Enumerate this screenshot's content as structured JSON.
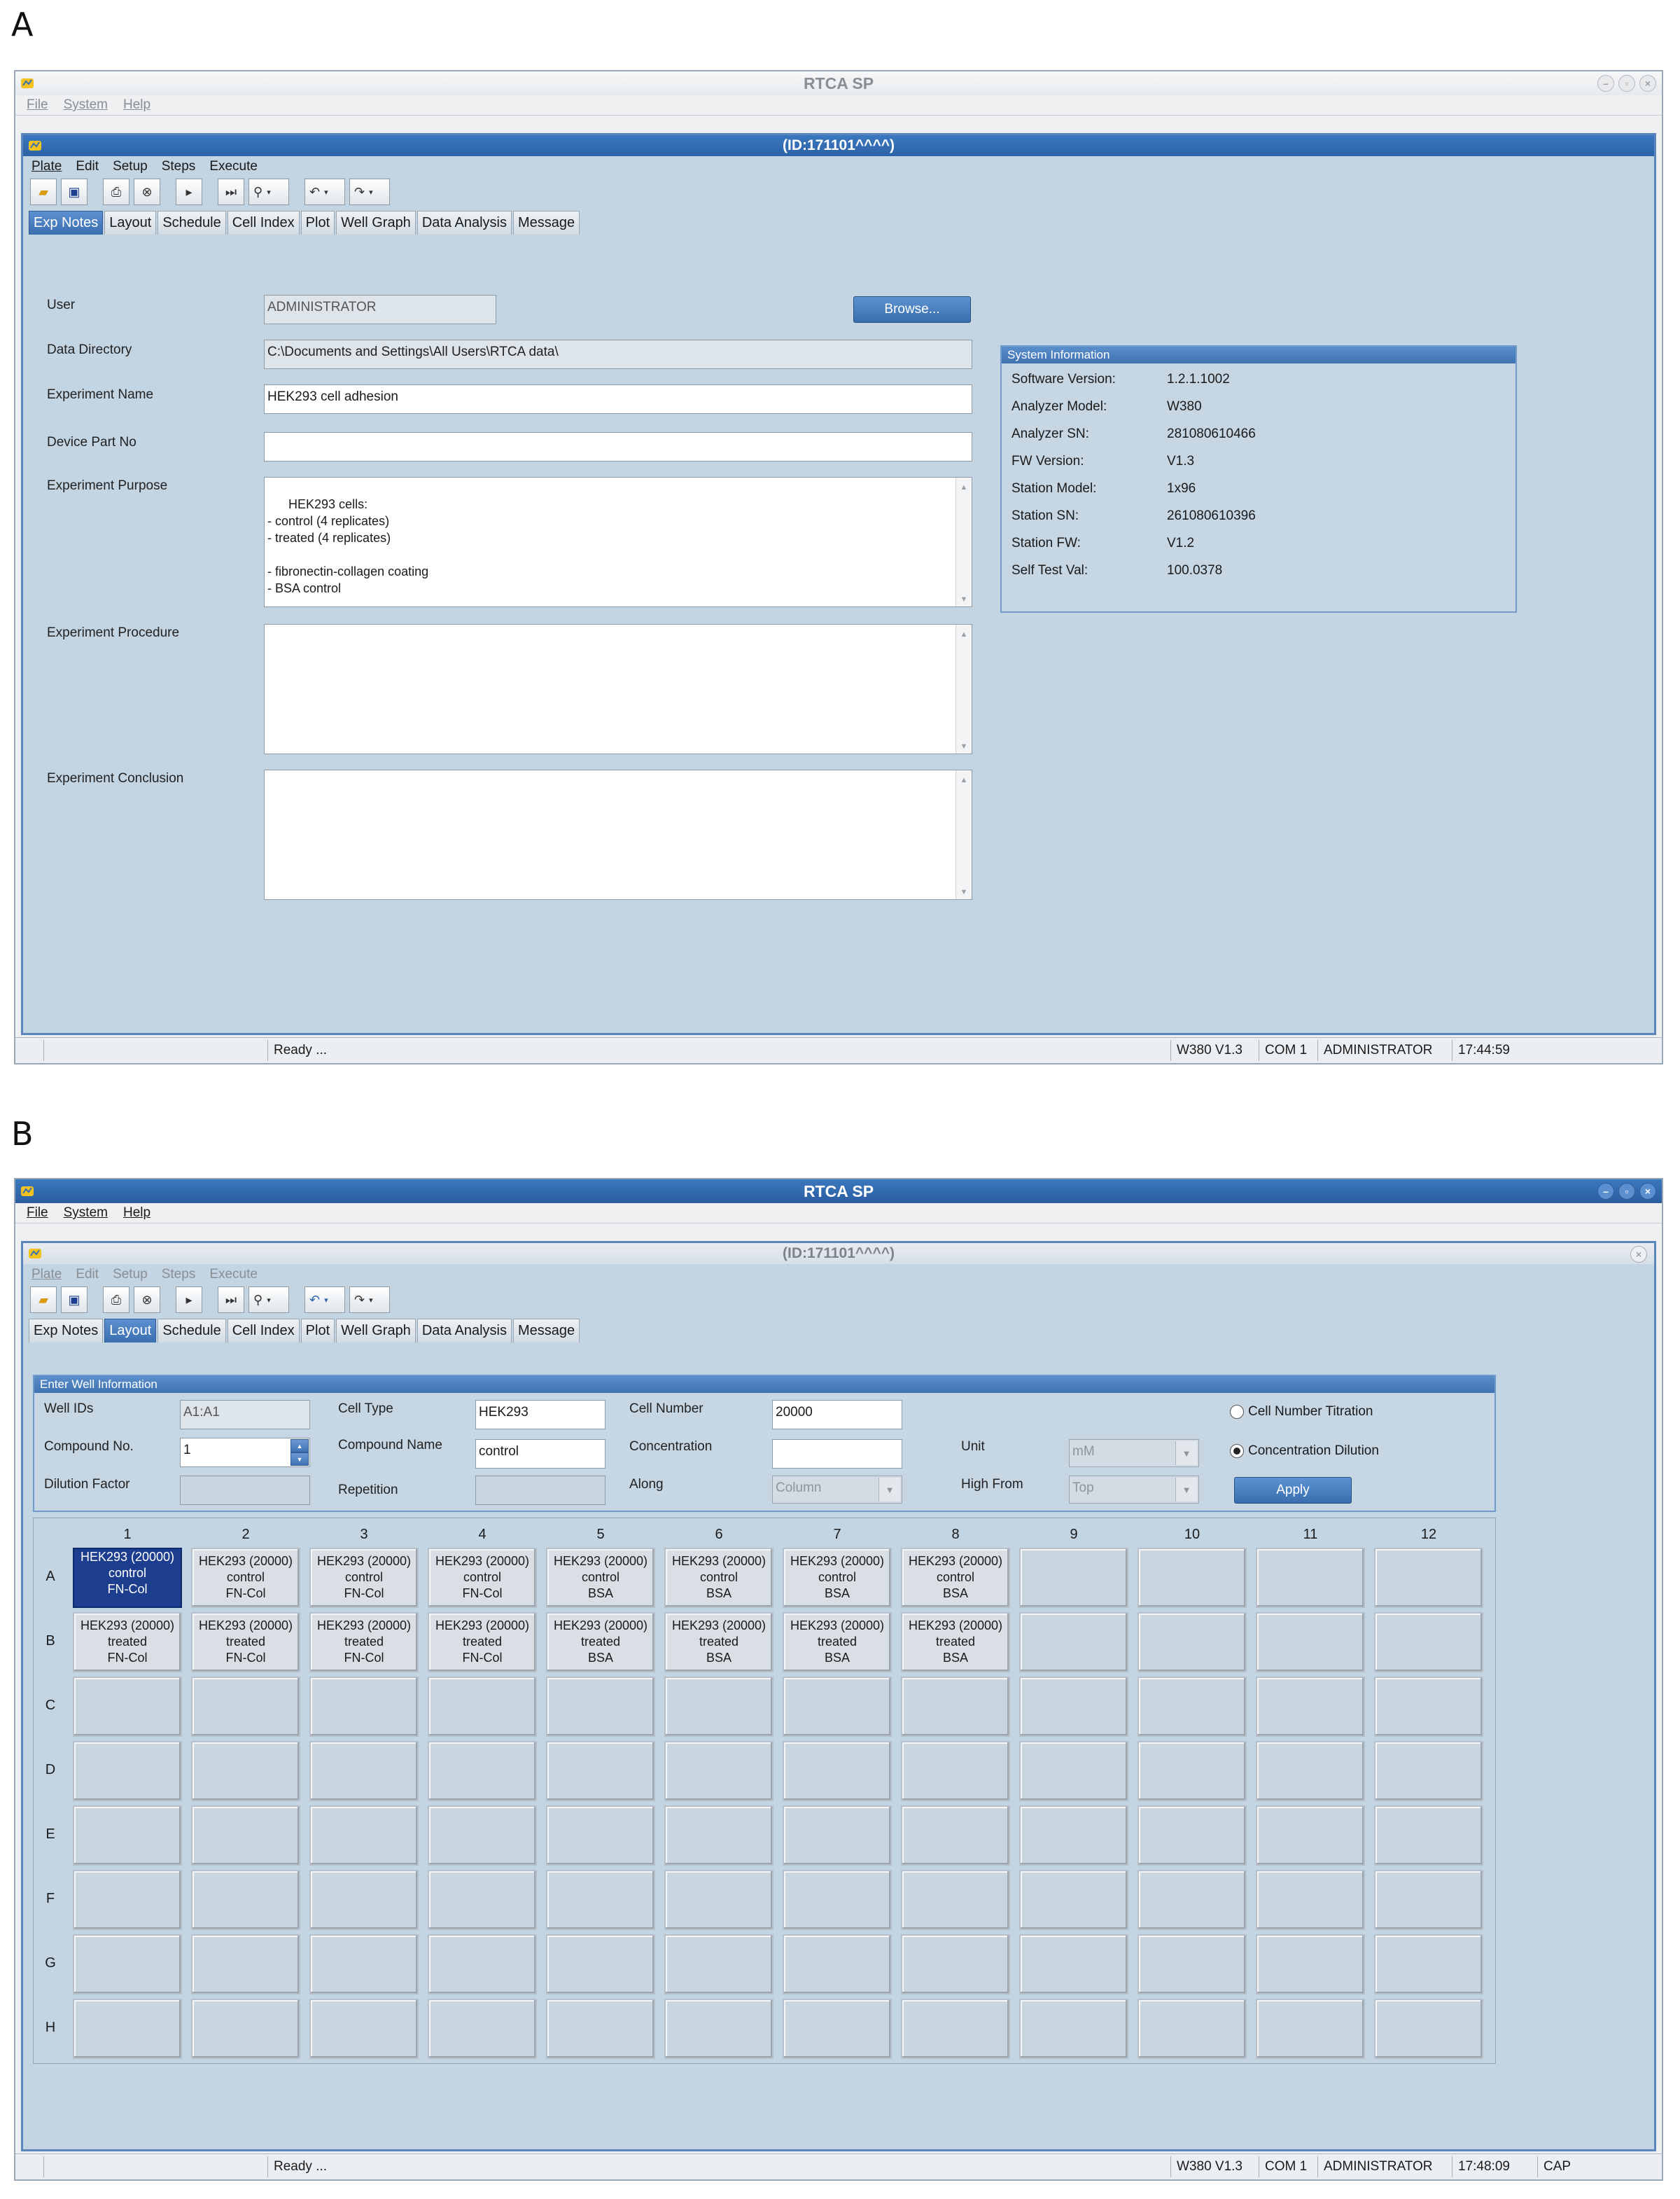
{
  "panel_a": {
    "letter": "A",
    "window_title": "RTCA SP",
    "menu": [
      "File",
      "System",
      "Help"
    ],
    "doc_title": "(ID:171101^^^^)",
    "doc_menu": [
      "Plate",
      "Edit",
      "Setup",
      "Steps",
      "Execute"
    ],
    "tabs": [
      "Exp Notes",
      "Layout",
      "Schedule",
      "Cell Index",
      "Plot",
      "Well Graph",
      "Data Analysis",
      "Message"
    ],
    "selected_tab": "Exp Notes",
    "form": {
      "user_label": "User",
      "user_value": "ADMINISTRATOR",
      "browse_label": "Browse...",
      "data_dir_label": "Data Directory",
      "data_dir_value": "C:\\Documents and Settings\\All Users\\RTCA data\\",
      "exp_name_label": "Experiment Name",
      "exp_name_value": "HEK293 cell adhesion",
      "device_part_label": "Device Part No",
      "device_part_value": "",
      "purpose_label": "Experiment Purpose",
      "purpose_value": "HEK293 cells:\n- control (4 replicates)\n- treated (4 replicates)\n\n- fibronectin-collagen coating\n- BSA control",
      "procedure_label": "Experiment Procedure",
      "procedure_value": "",
      "conclusion_label": "Experiment Conclusion",
      "conclusion_value": ""
    },
    "system_info": {
      "title": "System Information",
      "rows": [
        {
          "label": "Software Version:",
          "value": "1.2.1.1002"
        },
        {
          "label": "Analyzer Model:",
          "value": "W380"
        },
        {
          "label": "Analyzer SN:",
          "value": "281080610466"
        },
        {
          "label": "FW Version:",
          "value": "V1.3"
        },
        {
          "label": "Station Model:",
          "value": "1x96"
        },
        {
          "label": "Station SN:",
          "value": "261080610396"
        },
        {
          "label": "Station FW:",
          "value": "V1.2"
        },
        {
          "label": "Self Test Val:",
          "value": "100.0378"
        }
      ]
    },
    "status": {
      "text": "Ready ...",
      "analyzer": "W380 V1.3",
      "port": "COM 1",
      "user": "ADMINISTRATOR",
      "time": "17:44:59"
    }
  },
  "panel_b": {
    "letter": "B",
    "window_title": "RTCA SP",
    "menu": [
      "File",
      "System",
      "Help"
    ],
    "doc_title": "(ID:171101^^^^)",
    "doc_menu": [
      "Plate",
      "Edit",
      "Setup",
      "Steps",
      "Execute"
    ],
    "tabs": [
      "Exp Notes",
      "Layout",
      "Schedule",
      "Cell Index",
      "Plot",
      "Well Graph",
      "Data Analysis",
      "Message"
    ],
    "selected_tab": "Layout",
    "well_info": {
      "title": "Enter Well Information",
      "well_ids_label": "Well IDs",
      "well_ids_value": "A1:A1",
      "cell_type_label": "Cell Type",
      "cell_type_value": "HEK293",
      "cell_number_label": "Cell Number",
      "cell_number_value": "20000",
      "compound_no_label": "Compound No.",
      "compound_no_value": "1",
      "compound_name_label": "Compound Name",
      "compound_name_value": "control",
      "concentration_label": "Concentration",
      "concentration_value": "",
      "unit_label": "Unit",
      "unit_value": "mM",
      "dilution_label": "Dilution Factor",
      "dilution_value": "",
      "repetition_label": "Repetition",
      "repetition_value": "",
      "along_label": "Along",
      "along_value": "Column",
      "high_from_label": "High From",
      "high_from_value": "Top",
      "radio_titration": "Cell Number Titration",
      "radio_dilution": "Concentration Dilution",
      "apply_label": "Apply"
    },
    "plate": {
      "columns": [
        "1",
        "2",
        "3",
        "4",
        "5",
        "6",
        "7",
        "8",
        "9",
        "10",
        "11",
        "12"
      ],
      "rows": [
        "A",
        "B",
        "C",
        "D",
        "E",
        "F",
        "G",
        "H"
      ],
      "row_a": [
        [
          "HEK293 (20000)",
          "control",
          "FN-Col"
        ],
        [
          "HEK293 (20000)",
          "control",
          "FN-Col"
        ],
        [
          "HEK293 (20000)",
          "control",
          "FN-Col"
        ],
        [
          "HEK293 (20000)",
          "control",
          "FN-Col"
        ],
        [
          "HEK293 (20000)",
          "control",
          "BSA"
        ],
        [
          "HEK293 (20000)",
          "control",
          "BSA"
        ],
        [
          "HEK293 (20000)",
          "control",
          "BSA"
        ],
        [
          "HEK293 (20000)",
          "control",
          "BSA"
        ]
      ],
      "row_b": [
        [
          "HEK293 (20000)",
          "treated",
          "FN-Col"
        ],
        [
          "HEK293 (20000)",
          "treated",
          "FN-Col"
        ],
        [
          "HEK293 (20000)",
          "treated",
          "FN-Col"
        ],
        [
          "HEK293 (20000)",
          "treated",
          "FN-Col"
        ],
        [
          "HEK293 (20000)",
          "treated",
          "BSA"
        ],
        [
          "HEK293 (20000)",
          "treated",
          "BSA"
        ],
        [
          "HEK293 (20000)",
          "treated",
          "BSA"
        ],
        [
          "HEK293 (20000)",
          "treated",
          "BSA"
        ]
      ]
    },
    "status": {
      "text": "Ready ...",
      "analyzer": "W380 V1.3",
      "port": "COM 1",
      "user": "ADMINISTRATOR",
      "time": "17:48:09",
      "caps": "CAP"
    }
  }
}
